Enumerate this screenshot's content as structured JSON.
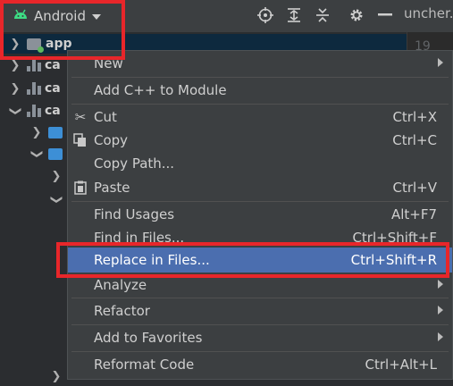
{
  "toolbar": {
    "project_view": "Android",
    "editor_tab_title": "uncher."
  },
  "tree": {
    "rows": [
      {
        "label": "app"
      },
      {
        "label": "ca"
      },
      {
        "label": "ca"
      },
      {
        "label": "ca"
      }
    ],
    "gutter_line": "19"
  },
  "menu": {
    "new": "New",
    "add_cpp": "Add C++ to Module",
    "cut": {
      "label": "Cut",
      "shortcut": "Ctrl+X"
    },
    "copy": {
      "label": "Copy",
      "shortcut": "Ctrl+C"
    },
    "copy_path": "Copy Path...",
    "paste": {
      "label": "Paste",
      "shortcut": "Ctrl+V"
    },
    "find_usages": {
      "label": "Find Usages",
      "shortcut": "Alt+F7"
    },
    "find_in_files": {
      "label": "Find in Files...",
      "shortcut": "Ctrl+Shift+F"
    },
    "replace_in_files": {
      "label": "Replace in Files...",
      "shortcut": "Ctrl+Shift+R"
    },
    "analyze": "Analyze",
    "refactor": "Refactor",
    "add_favorites": "Add to Favorites",
    "reformat": {
      "label": "Reformat Code",
      "shortcut": "Ctrl+Alt+L"
    }
  },
  "colors": {
    "highlight": "#4b6eaf",
    "annotation": "#e8262a",
    "android_green": "#3ddc84"
  }
}
